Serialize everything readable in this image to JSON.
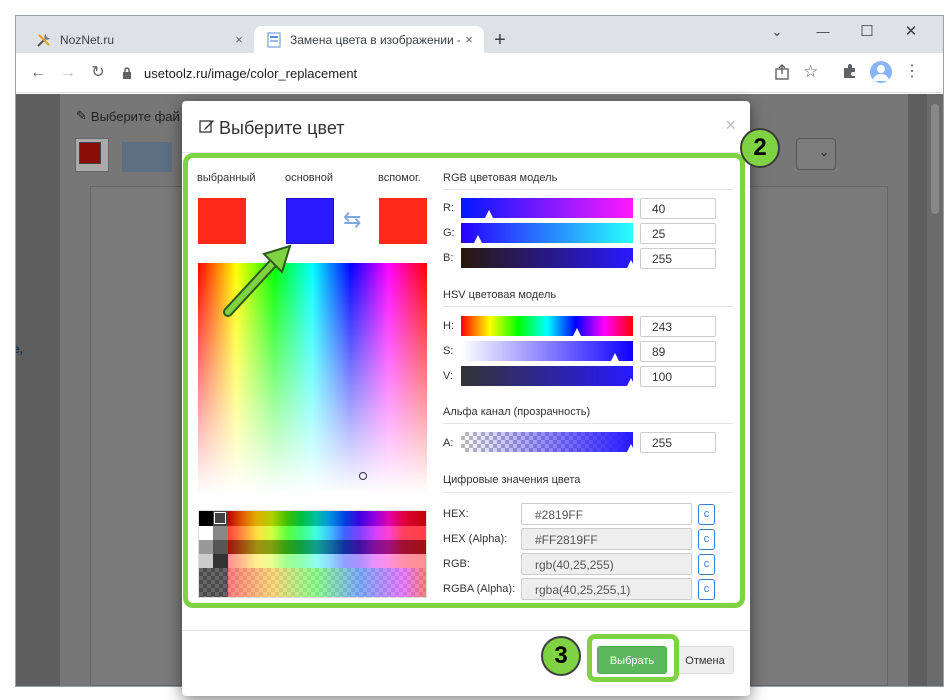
{
  "browser": {
    "tabs": [
      {
        "title": "NozNet.ru",
        "close": "×"
      },
      {
        "title": "Замена цвета в изображении -",
        "close": "×"
      }
    ],
    "new_tab": "+",
    "url": "usetoolz.ru/image/color_replacement",
    "window_controls": {
      "dropdown": "⌄",
      "minimize": "—",
      "maximize": "☐",
      "close": "✕"
    }
  },
  "background_page": {
    "header_text": "Выберите фай",
    "side_text": "е,"
  },
  "dialog": {
    "title": "Выберите цвет",
    "close": "×",
    "swatches": {
      "selected_label": "выбранный",
      "main_label": "основной",
      "secondary_label": "вспомог.",
      "selected_color": "#FF2819",
      "main_color": "#2819FF",
      "secondary_color": "#FF2819",
      "swap_icon": "⇆"
    },
    "rgb": {
      "heading": "RGB цветовая модель",
      "r_label": "R:",
      "r_value": "40",
      "g_label": "G:",
      "g_value": "25",
      "b_label": "B:",
      "b_value": "255"
    },
    "hsv": {
      "heading": "HSV цветовая модель",
      "h_label": "H:",
      "h_value": "243",
      "s_label": "S:",
      "s_value": "89",
      "v_label": "V:",
      "v_value": "100"
    },
    "alpha": {
      "heading": "Альфа канал (прозрачность)",
      "a_label": "A:",
      "a_value": "255"
    },
    "digital": {
      "heading": "Цифровые значения цвета",
      "hex_label": "HEX:",
      "hex_value": "#2819FF",
      "hexa_label": "HEX (Alpha):",
      "hexa_value": "#FF2819FF",
      "rgb_label": "RGB:",
      "rgb_value": "rgb(40,25,255)",
      "rgba_label": "RGBA (Alpha):",
      "rgba_value": "rgba(40,25,255,1)",
      "copy_label": "c"
    },
    "buttons": {
      "select": "Выбрать",
      "cancel": "Отмена"
    }
  },
  "annotations": {
    "step2": "2",
    "step3": "3",
    "highlight_color": "#7FD342",
    "arrow_color": "#4CAF50"
  }
}
